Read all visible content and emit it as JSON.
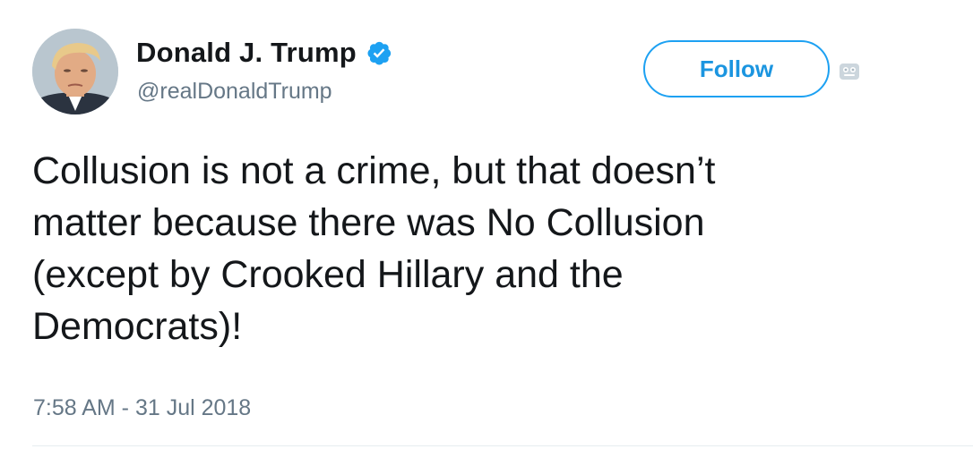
{
  "user": {
    "display_name": "Donald J. Trump",
    "handle": "@realDonaldTrump",
    "verified": true,
    "avatar_icon": "profile-photo"
  },
  "actions": {
    "follow_label": "Follow",
    "more_icon": "caret-menu-icon"
  },
  "tweet": {
    "text": "Collusion is not a crime, but that doesn’t\nmatter because there was No Collusion\n(except by Crooked Hillary and the\nDemocrats)!",
    "timestamp": "7:58 AM - 31 Jul 2018"
  },
  "colors": {
    "accent": "#1da1f2",
    "text": "#14171a",
    "muted": "#657786",
    "divider": "#e6ecf0"
  }
}
